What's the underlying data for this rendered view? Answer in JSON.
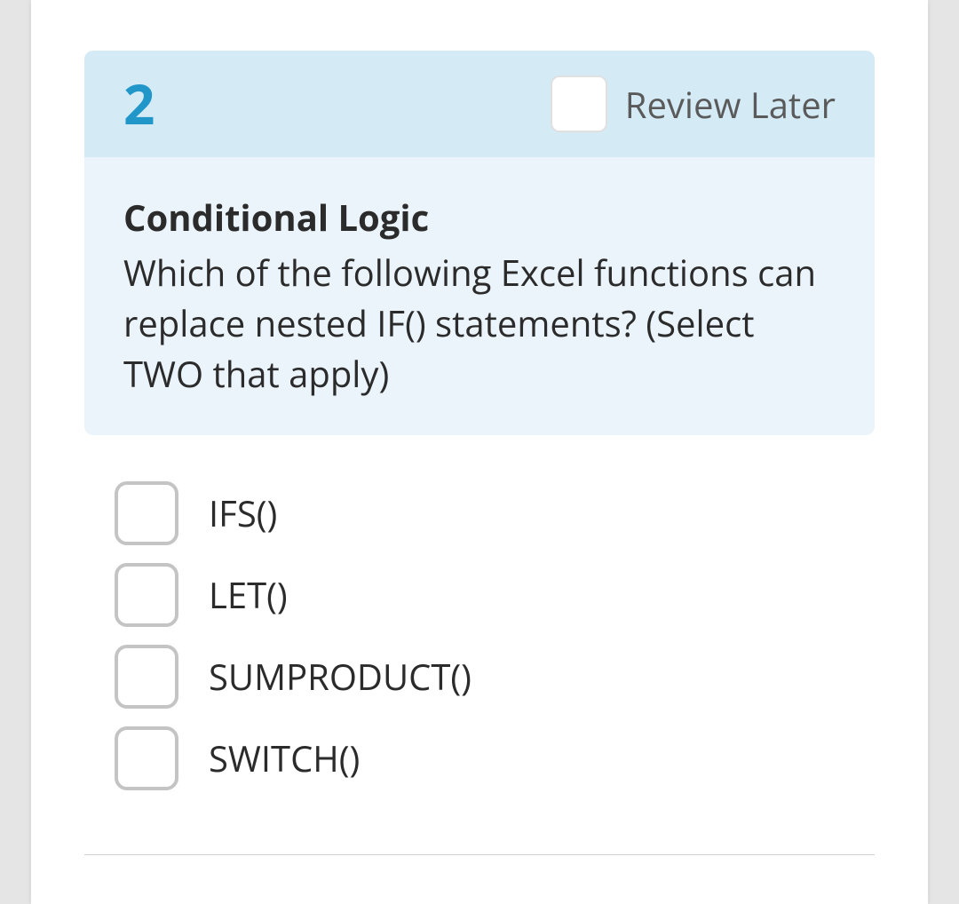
{
  "question": {
    "number": "2",
    "review_later_label": "Review Later",
    "title": "Conditional Logic",
    "text": "Which of the following Excel functions can replace nested IF() statements? (Select TWO that apply)",
    "options": [
      {
        "label": "IFS()"
      },
      {
        "label": "LET()"
      },
      {
        "label": "SUMPRODUCT()"
      },
      {
        "label": "SWITCH()"
      }
    ]
  }
}
